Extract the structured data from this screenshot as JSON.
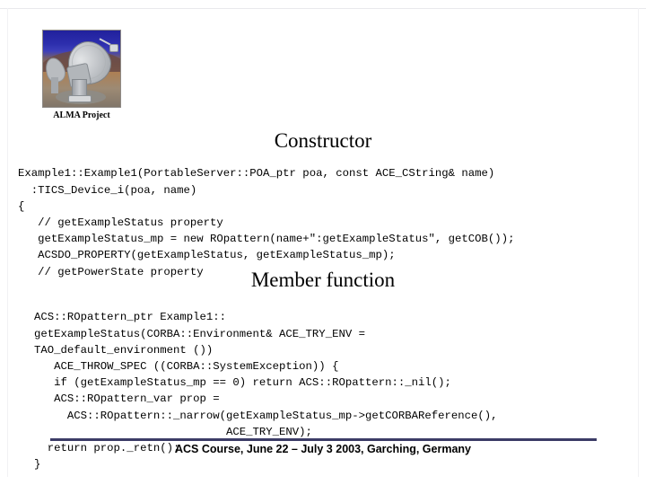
{
  "slide": {
    "logo": {
      "image_alt": "alma-antenna-photo",
      "caption": "ALMA Project"
    },
    "sections": [
      {
        "heading": "Constructor",
        "code": "Example1::Example1(PortableServer::POA_ptr poa, const ACE_CString& name)\n  :TICS_Device_i(poa, name)\n{\n   // getExampleStatus property\n   getExampleStatus_mp = new ROpattern(name+\":getExampleStatus\", getCOB());\n   ACSDO_PROPERTY(getExampleStatus, getExampleStatus_mp);\n   // getPowerState property"
      },
      {
        "heading": "Member function",
        "code": "ACS::ROpattern_ptr Example1::\ngetExampleStatus(CORBA::Environment& ACE_TRY_ENV =\nTAO_default_environment ())\n   ACE_THROW_SPEC ((CORBA::SystemException)) {\n   if (getExampleStatus_mp == 0) return ACS::ROpattern::_nil();\n   ACS::ROpattern_var prop =\n     ACS::ROpattern::_narrow(getExampleStatus_mp->getCORBAReference(),\n                             ACE_TRY_ENV);\n  return prop._retn();\n}"
      }
    ],
    "footer": {
      "text": "ACS Course, June 22 – July 3 2003, Garching, Germany",
      "rule_color": "#3b3b66"
    }
  }
}
